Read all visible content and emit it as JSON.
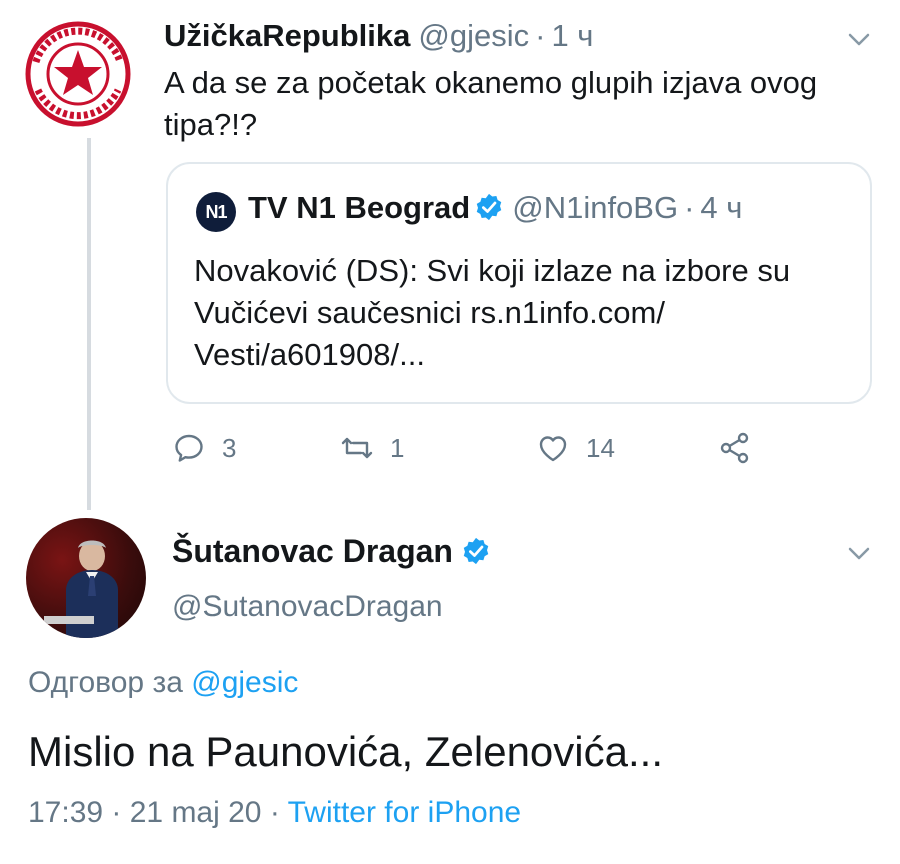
{
  "tweet": {
    "name": "UžičkaRepublika",
    "handle": "@gjesic",
    "separator": "·",
    "time": "1 ч",
    "text": "A da se za početak okanemo glupih izjava ovog tipa?!?",
    "avatar_icon": "red-star-stamp-icon"
  },
  "quoted": {
    "logo": "N1",
    "name": "TV N1 Beograd",
    "handle": "@N1infoBG",
    "separator": "·",
    "time": "4 ч",
    "text": "Novaković (DS): Svi koji izlaze na izbore su Vučićevi saučesnici rs.n1info.com/ Vesti/a601908/..."
  },
  "actions": {
    "reply_count": "3",
    "retweet_count": "1",
    "like_count": "14"
  },
  "reply": {
    "name": "Šutanovac Dragan",
    "handle": "@SutanovacDragan",
    "reply_to_label": "Одговор за",
    "reply_to_handle": "@gjesic",
    "text": "Mislio na Paunovića, Zelenovića...",
    "timestamp": "17:39 · 21 maj 20",
    "separator": "·",
    "source": "Twitter for iPhone"
  },
  "colors": {
    "accent": "#1da1f2",
    "secondary_text": "#657786",
    "primary_text": "#14171a",
    "border": "#e1e8ed"
  }
}
